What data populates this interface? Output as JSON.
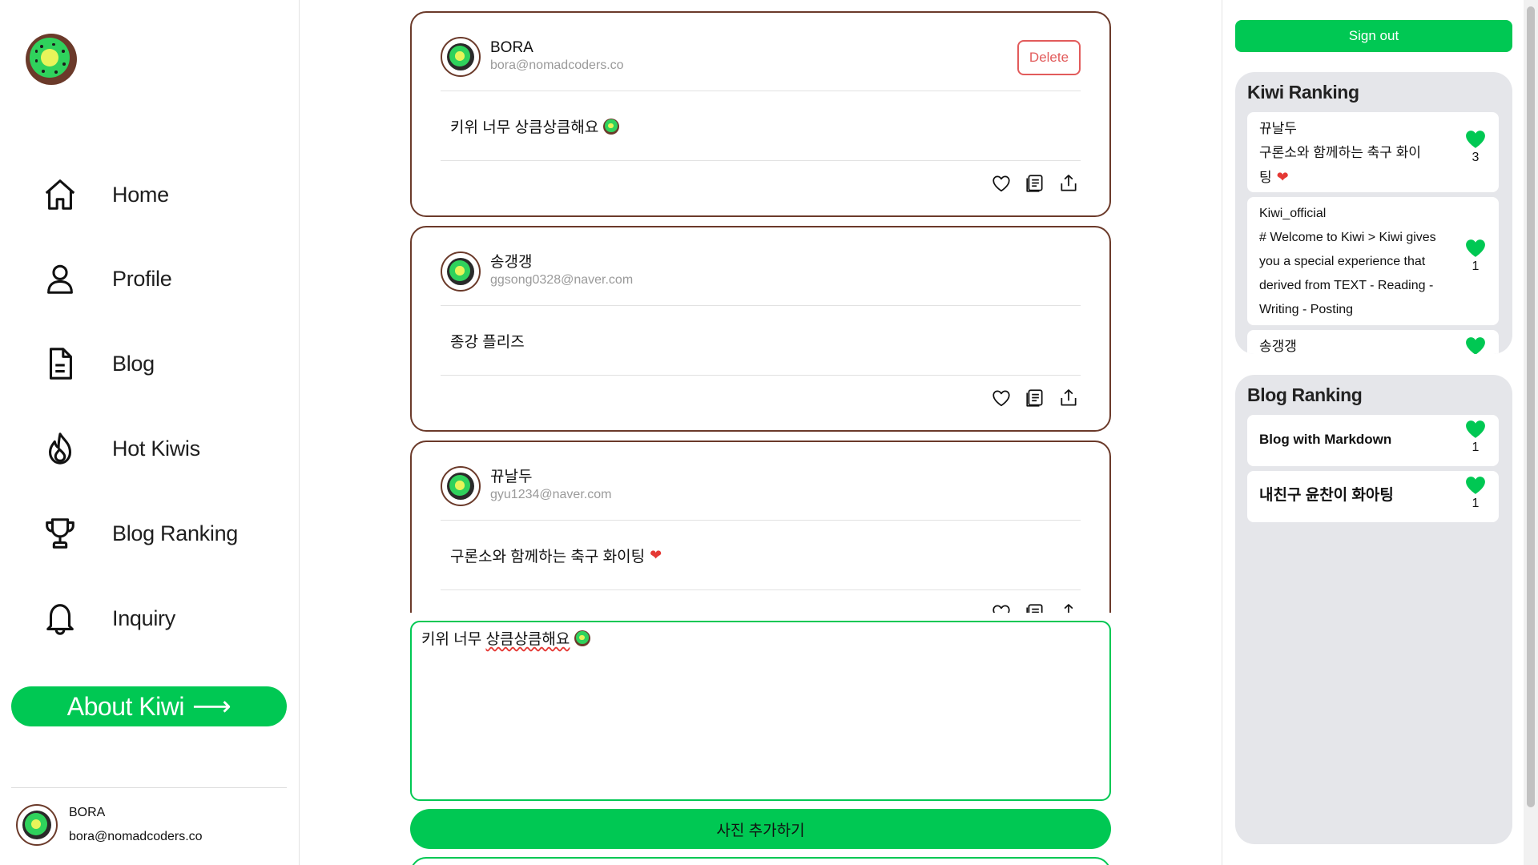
{
  "sidebar": {
    "nav": [
      {
        "label": "Home",
        "icon": "home-icon"
      },
      {
        "label": "Profile",
        "icon": "user-icon"
      },
      {
        "label": "Blog",
        "icon": "document-icon"
      },
      {
        "label": "Hot Kiwis",
        "icon": "flame-icon"
      },
      {
        "label": "Blog Ranking",
        "icon": "trophy-icon"
      },
      {
        "label": "Inquiry",
        "icon": "bell-icon"
      }
    ],
    "about_label": "About Kiwi",
    "about_arrow": "⟶",
    "user": {
      "name": "BORA",
      "email": "bora@nomadcoders.co"
    }
  },
  "feed": {
    "posts": [
      {
        "name": "BORA",
        "email": "bora@nomadcoders.co",
        "text": "키위 너무 상큼상큼해요",
        "delete_label": "Delete",
        "emoji": "kiwi"
      },
      {
        "name": "송갱갱",
        "email": "ggsong0328@naver.com",
        "text": "종강 플리즈"
      },
      {
        "name": "뀨날두",
        "email": "gyu1234@naver.com",
        "text": "구론소와 함께하는 축구 화이팅",
        "emoji": "red-heart",
        "emoji_char": "❤"
      }
    ]
  },
  "composer": {
    "prefix": "키위 너무 ",
    "misspelled": "상큼상큼해요"
  },
  "photo_button": "사진 추가하기",
  "right": {
    "signout": "Sign out",
    "kiwi_ranking": {
      "title": "Kiwi Ranking",
      "items": [
        {
          "user": "뀨날두",
          "text": "구론소와 함께하는 축구 화이",
          "text2": "팅",
          "likes": "3"
        },
        {
          "user": "Kiwi_official",
          "text": "# Welcome to Kiwi > Kiwi gives you a special experience that derived from TEXT - Reading - Writing - Posting",
          "likes": "1"
        },
        {
          "user": "송갱갱"
        }
      ]
    },
    "blog_ranking": {
      "title": "Blog Ranking",
      "items": [
        {
          "text": "Blog with Markdown",
          "likes": "1"
        },
        {
          "text": "내친구 윤찬이 화아팅",
          "likes": "1"
        }
      ]
    }
  },
  "colors": {
    "accent": "#00c853",
    "brown": "#6b3a2a",
    "danger": "#e25b5b",
    "panel": "#e5e6ea"
  }
}
